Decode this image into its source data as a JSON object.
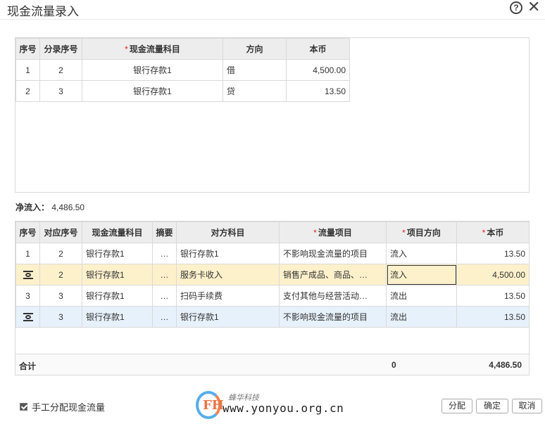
{
  "window": {
    "title": "现金流量录入",
    "help_icon": "question-circle-icon",
    "close_icon": "close-icon"
  },
  "top_table": {
    "headers": [
      "序号",
      "分录序号",
      "现金流量科目",
      "方向",
      "本币"
    ],
    "required": [
      false,
      false,
      true,
      false,
      false
    ],
    "rows": [
      [
        "1",
        "2",
        "银行存款1",
        "借",
        "4,500.00"
      ],
      [
        "2",
        "3",
        "银行存款1",
        "贷",
        "13.50"
      ]
    ]
  },
  "net_inflow": {
    "label": "净流入：",
    "value": "4,486.50"
  },
  "bottom_table": {
    "headers": [
      "序号",
      "对应序号",
      "现金流量科目",
      "摘要",
      "对方科目",
      "流量项目",
      "项目方向",
      "本币"
    ],
    "required": [
      false,
      false,
      false,
      false,
      false,
      true,
      true,
      true
    ],
    "rows": [
      {
        "seq": "1",
        "ref": "2",
        "subject": "银行存款1",
        "summary": "…",
        "counter": "银行存款1",
        "item": "不影响现金流量的项目",
        "direction": "流入",
        "amount": "13.50"
      },
      {
        "seq": "",
        "ref": "2",
        "subject": "银行存款1",
        "summary": "…",
        "counter": "服务卡收入",
        "item": "销售产成品、商品、…",
        "direction": "流入",
        "amount": "4,500.00"
      },
      {
        "seq": "3",
        "ref": "3",
        "subject": "银行存款1",
        "summary": "…",
        "counter": "扫码手续费",
        "item": "支付其他与经营活动…",
        "direction": "流出",
        "amount": "13.50"
      },
      {
        "seq": "",
        "ref": "3",
        "subject": "银行存款1",
        "summary": "…",
        "counter": "银行存款1",
        "item": "不影响现金流量的项目",
        "direction": "流出",
        "amount": "13.50"
      }
    ],
    "total": {
      "label": "合计",
      "direction_total": "0",
      "amount_total": "4,486.50"
    }
  },
  "footer": {
    "manual_label": "手工分配现金流量",
    "manual_checked": true,
    "buttons": {
      "allocate": "分配",
      "confirm": "确定",
      "cancel": "取消"
    }
  },
  "watermark": {
    "brand": "蜂华科技",
    "url": "www.yonyou.org.cn",
    "logo_letters": "FH"
  },
  "colors": {
    "selected_row": "#fdf1cc",
    "hover_row": "#e7f1fb",
    "required_star": "#e02020",
    "header_bg": "#ededed"
  }
}
